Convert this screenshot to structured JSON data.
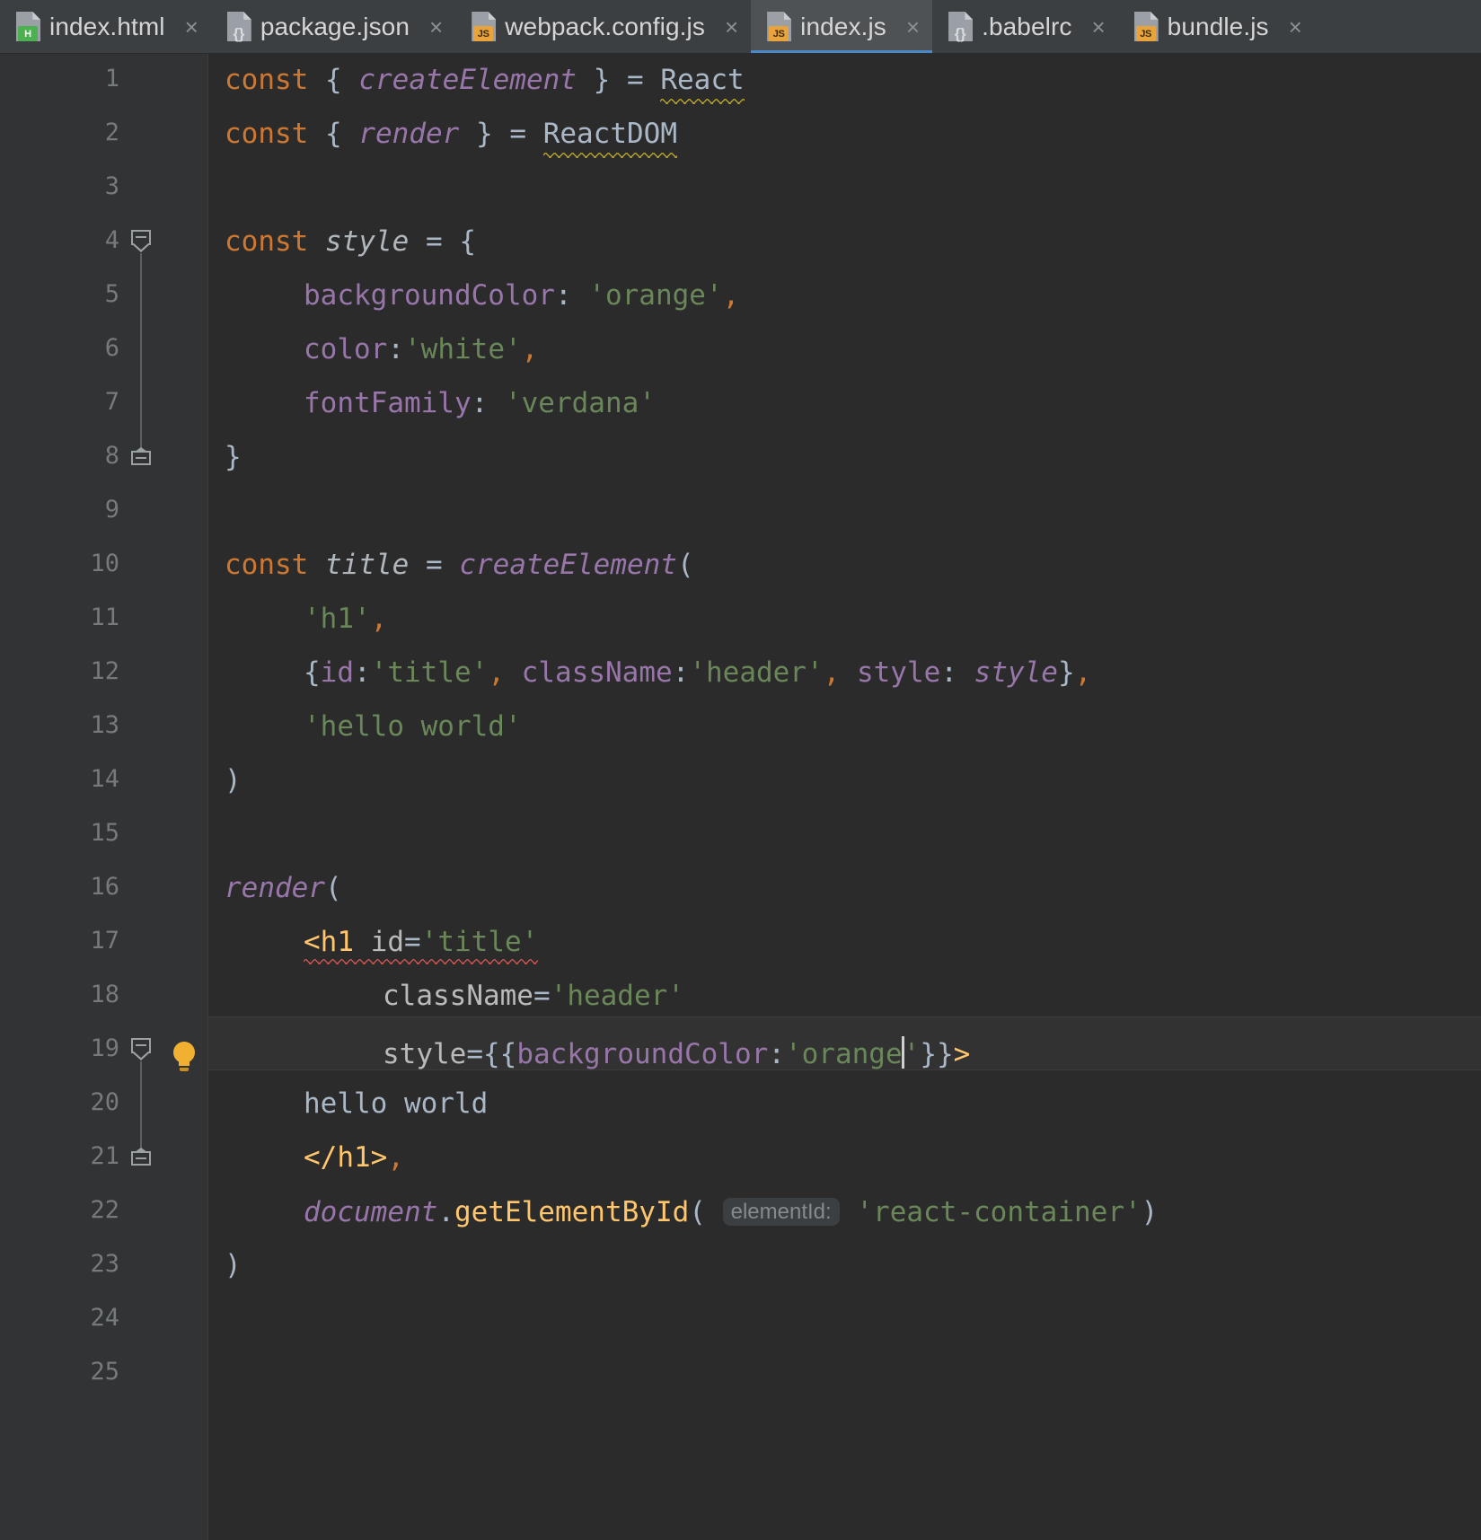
{
  "window": {
    "app": "jetbrains-ide",
    "theme": "darcula",
    "colors": {
      "editor_bg": "#2b2b2b",
      "gutter_bg": "#313335",
      "tabbar_bg": "#3c3f41",
      "active_tab_bg": "#4e5254",
      "active_tab_underline": "#4a88c7",
      "keyword": "#cc7832",
      "string": "#6a8759",
      "property": "#9876aa",
      "function": "#ffc66d",
      "default_text": "#a9b7c6",
      "line_number": "#757a7d",
      "warning_squiggle": "#b3a12c",
      "error_squiggle": "#c75450",
      "caret_line": "#323232",
      "bulb": "#f0b132"
    }
  },
  "tabs": [
    {
      "label": "index.html",
      "icon": "html-file-icon",
      "badge": "H",
      "badge_kind": "html",
      "active": false,
      "close_glyph": "×"
    },
    {
      "label": "package.json",
      "icon": "json-file-icon",
      "badge": "{}",
      "badge_kind": "json",
      "active": false,
      "close_glyph": "×"
    },
    {
      "label": "webpack.config.js",
      "icon": "js-file-icon",
      "badge": "JS",
      "badge_kind": "js",
      "active": false,
      "close_glyph": "×"
    },
    {
      "label": "index.js",
      "icon": "js-file-icon",
      "badge": "JS",
      "badge_kind": "js",
      "active": true,
      "close_glyph": "×"
    },
    {
      "label": ".babelrc",
      "icon": "json-file-icon",
      "badge": "{}",
      "badge_kind": "json",
      "active": false,
      "close_glyph": "×"
    },
    {
      "label": "bundle.js",
      "icon": "js-file-icon",
      "badge": "JS",
      "badge_kind": "js",
      "active": false,
      "close_glyph": "×"
    }
  ],
  "editor": {
    "file": "index.js",
    "caret_line_number": 19,
    "line_numbers": [
      1,
      2,
      3,
      4,
      5,
      6,
      7,
      8,
      9,
      10,
      11,
      12,
      13,
      14,
      15,
      16,
      17,
      18,
      19,
      20,
      21,
      22,
      23,
      24,
      25
    ],
    "intention_bulb": {
      "name": "intention-lightbulb",
      "line": 19
    },
    "inlay_hint": {
      "text": "elementId:",
      "line": 22
    },
    "lines": [
      {
        "n": 1,
        "text": "const { createElement } = React"
      },
      {
        "n": 2,
        "text": "const { render } = ReactDOM"
      },
      {
        "n": 3,
        "text": ""
      },
      {
        "n": 4,
        "text": "const style = {"
      },
      {
        "n": 5,
        "text": "    backgroundColor: 'orange',"
      },
      {
        "n": 6,
        "text": "    color:'white',"
      },
      {
        "n": 7,
        "text": "    fontFamily: 'verdana'"
      },
      {
        "n": 8,
        "text": "}"
      },
      {
        "n": 9,
        "text": ""
      },
      {
        "n": 10,
        "text": "const title = createElement("
      },
      {
        "n": 11,
        "text": "    'h1',"
      },
      {
        "n": 12,
        "text": "    {id:'title', className:'header', style: style},"
      },
      {
        "n": 13,
        "text": "    'hello world'"
      },
      {
        "n": 14,
        "text": ")"
      },
      {
        "n": 15,
        "text": ""
      },
      {
        "n": 16,
        "text": "render("
      },
      {
        "n": 17,
        "text": "    <h1 id='title'"
      },
      {
        "n": 18,
        "text": "        className='header'"
      },
      {
        "n": 19,
        "text": "        style={{backgroundColor:'orange'}}>"
      },
      {
        "n": 20,
        "text": "    hello world"
      },
      {
        "n": 21,
        "text": "    </h1>,"
      },
      {
        "n": 22,
        "text": "    document.getElementById( elementId: 'react-container')"
      },
      {
        "n": 23,
        "text": ")"
      },
      {
        "n": 24,
        "text": ""
      },
      {
        "n": 25,
        "text": ""
      }
    ],
    "tokens": {
      "const": "const",
      "brace_open": "{",
      "brace_close": "}",
      "paren_open": "(",
      "paren_close": ")",
      "equals": "=",
      "comma": ",",
      "colon": ":",
      "createElement": "createElement",
      "render": "render",
      "React": "React",
      "ReactDOM": "ReactDOM",
      "style_var": "style",
      "title_var": "title",
      "document": "document",
      "getElementById": "getElementById",
      "backgroundColor": "backgroundColor",
      "color": "color",
      "fontFamily": "fontFamily",
      "id": "id",
      "className": "className",
      "style_key": "style",
      "h1_open": "<h1",
      "h1_close": "</h1>",
      "gt": ">",
      "str_orange": "'orange'",
      "str_white": "'white'",
      "str_verdana": "'verdana'",
      "str_h1": "'h1'",
      "str_title": "'title'",
      "str_header": "'header'",
      "str_hello_world": "'hello world'",
      "jsx_text_hello_world": "hello world",
      "str_react_container": "'react-container'"
    }
  }
}
